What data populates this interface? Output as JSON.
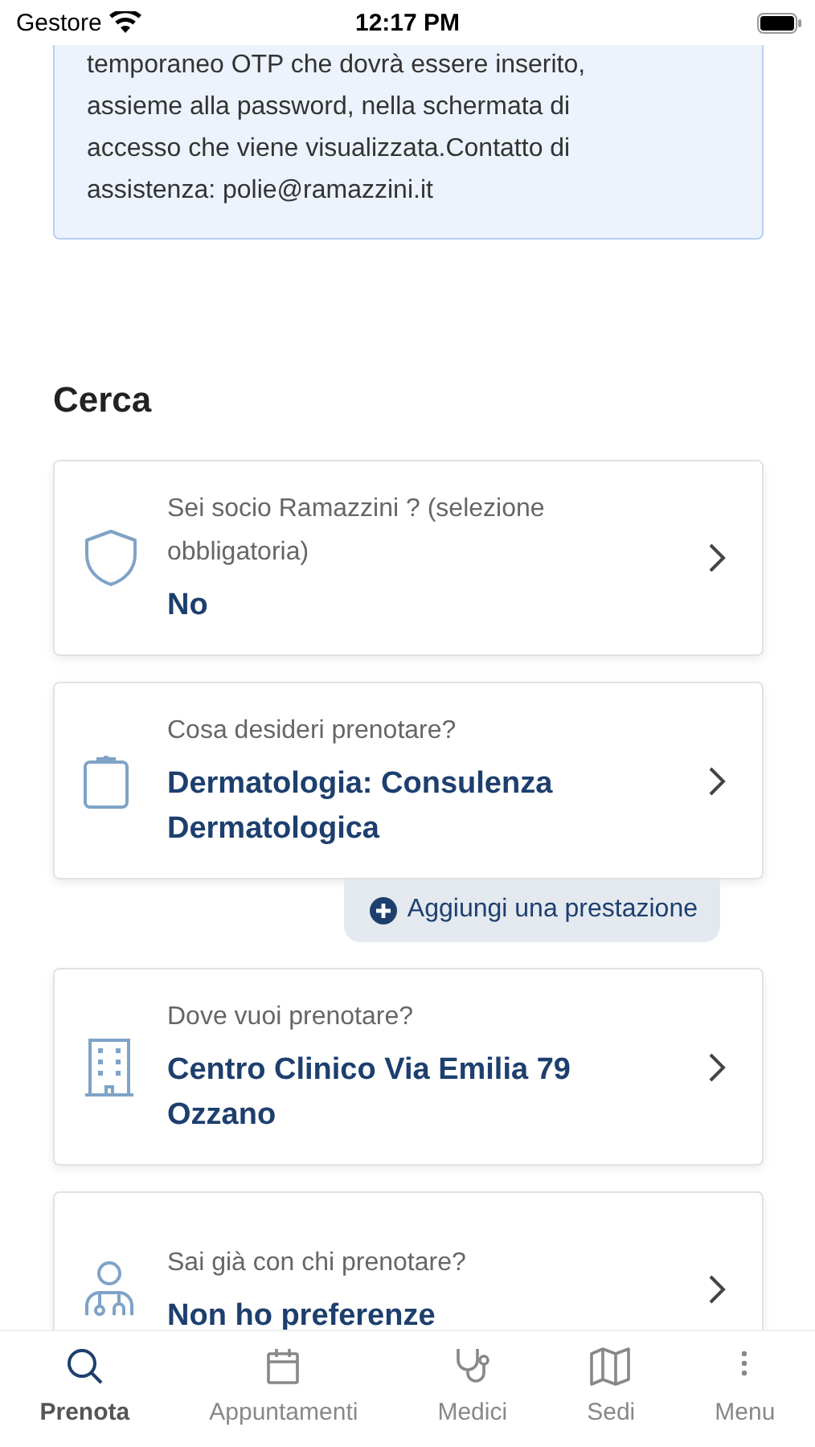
{
  "status_bar": {
    "carrier": "Gestore",
    "time": "12:17 PM"
  },
  "notice": {
    "text": "temporaneo OTP che dovrà essere inserito, assieme alla password, nella schermata di accesso che viene visualizzata.Contatto di assistenza: polie@ramazzini.it"
  },
  "search": {
    "title": "Cerca",
    "cards": [
      {
        "label": "Sei socio Ramazzini ? (selezione obbligatoria)",
        "value": "No"
      },
      {
        "label": "Cosa desideri prenotare?",
        "value": "Dermatologia: Consulenza Dermatologica"
      },
      {
        "label": "Dove vuoi prenotare?",
        "value": "Centro Clinico Via Emilia 79 Ozzano"
      },
      {
        "label": "Sai già con chi prenotare?",
        "value": "Non ho preferenze"
      }
    ],
    "add_button": "Aggiungi una prestazione"
  },
  "tab_bar": [
    {
      "label": "Prenota",
      "selected": true
    },
    {
      "label": "Appuntamenti",
      "selected": false
    },
    {
      "label": "Medici",
      "selected": false
    },
    {
      "label": "Sedi",
      "selected": false
    },
    {
      "label": "Menu",
      "selected": false
    }
  ]
}
